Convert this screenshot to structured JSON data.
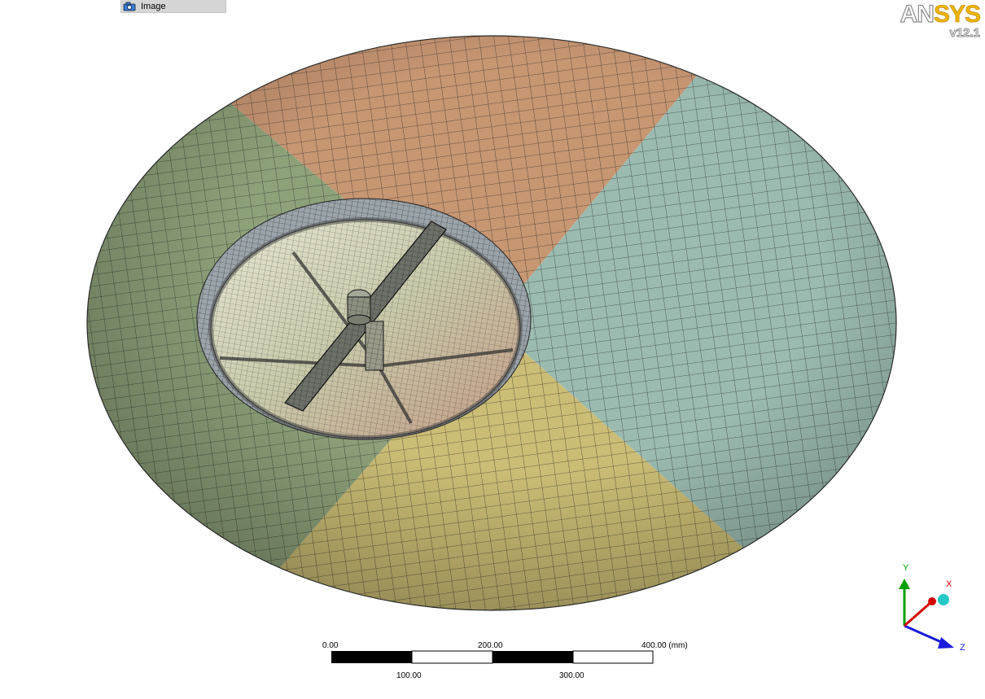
{
  "viewer": {
    "tab_label": "Image",
    "tab_icon": "camera-icon"
  },
  "logo": {
    "brand_part1": "AN",
    "brand_part2": "SYS",
    "version": "v12.1"
  },
  "scale_bar": {
    "top_labels": [
      "0.00",
      "200.00",
      "400.00 (mm)"
    ],
    "bottom_labels": [
      "100.00",
      "300.00"
    ]
  },
  "triad": {
    "x_label": "X",
    "y_label": "Y",
    "z_label": "Z",
    "colors": {
      "x": "#d40000",
      "y": "#00a000",
      "z": "#1a1adc",
      "iso_ball": "#25c8c8"
    }
  },
  "model": {
    "body_colors": {
      "green": "#8ea27a",
      "orange": "#c79673",
      "teal": "#9bbbb0",
      "yellow": "#cbbd75"
    },
    "mesh_color": "#1c1c1c"
  }
}
